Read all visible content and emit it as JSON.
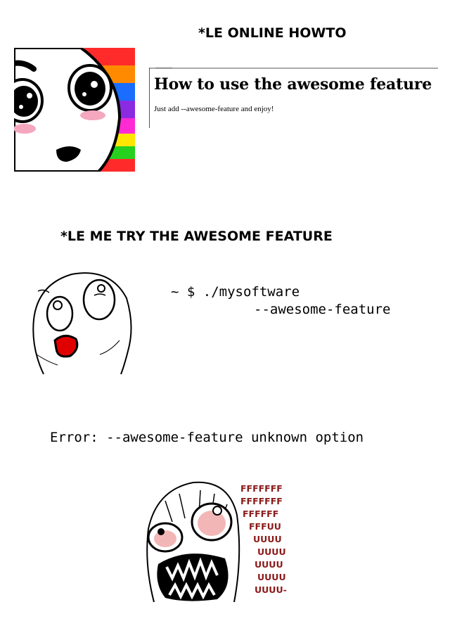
{
  "panel1": {
    "caption": "*LE ONLINE HOWTO",
    "page_title": "How to use the awesome feature",
    "page_text": "Just add --awesome-feature and enjoy!"
  },
  "panel2": {
    "caption": "*LE ME TRY THE AWESOME FEATURE",
    "command_line1": "~ $ ./mysoftware",
    "command_line2": "--awesome-feature"
  },
  "panel3": {
    "error": "Error: --awesome-feature unknown option",
    "rage_lines": [
      "FFFFFFF",
      "FFFFFFF",
      "FFFFFF",
      "FFFUU",
      "UUUU",
      "UUUU",
      "UUUU",
      "UUUU",
      "UUUU-"
    ]
  },
  "colors": {
    "rage_text": "#8b1a1a",
    "rainbow": [
      "#ff2a2a",
      "#ff8a00",
      "#ffe600",
      "#26d01f",
      "#1a6dff",
      "#8a2be2",
      "#ff2ad4"
    ]
  },
  "icons": [
    "amazed-face-icon",
    "eager-face-icon",
    "rage-face-icon"
  ]
}
